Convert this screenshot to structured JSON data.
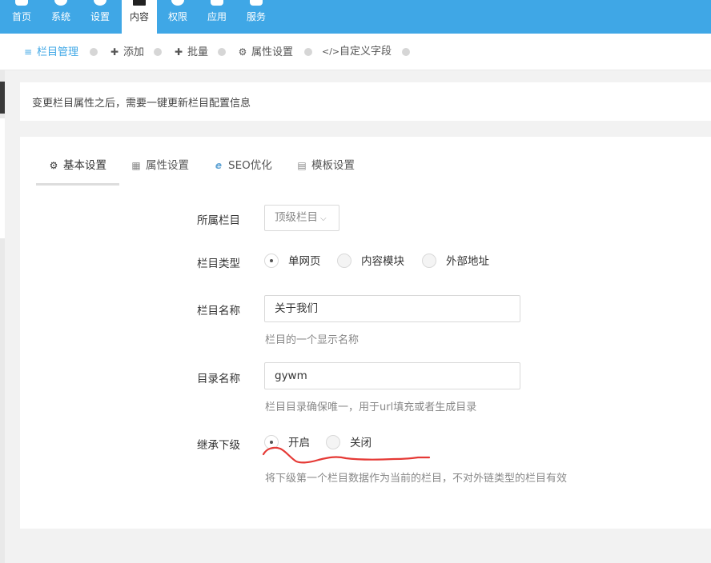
{
  "topnav": {
    "items": [
      {
        "label": "首页",
        "icon": "home-icon"
      },
      {
        "label": "系统",
        "icon": "globe-icon"
      },
      {
        "label": "设置",
        "icon": "gears-icon"
      },
      {
        "label": "内容",
        "icon": "grid-icon",
        "active": true
      },
      {
        "label": "权限",
        "icon": "user-icon"
      },
      {
        "label": "应用",
        "icon": "puzzle-icon"
      },
      {
        "label": "服务",
        "icon": "chat-icon"
      }
    ],
    "bg": "#3fa7e6"
  },
  "subbar": {
    "items": [
      {
        "label": "栏目管理",
        "icon": "≡",
        "active": true
      },
      {
        "label": "添加",
        "icon": "✚"
      },
      {
        "label": "批量",
        "icon": "✚"
      },
      {
        "label": "属性设置",
        "icon": "⚙"
      },
      {
        "label": "自定义字段",
        "icon": "</>"
      }
    ]
  },
  "notice": {
    "text": "变更栏目属性之后，需要一键更新栏目配置信息"
  },
  "tabs": [
    {
      "label": "基本设置",
      "icon": "⚙",
      "active": true
    },
    {
      "label": "属性设置",
      "icon": "▦"
    },
    {
      "label": "SEO优化",
      "icon": "e"
    },
    {
      "label": "模板设置",
      "icon": "▤"
    }
  ],
  "form": {
    "parent": {
      "label": "所属栏目",
      "value": "顶级栏目"
    },
    "type": {
      "label": "栏目类型",
      "options": [
        "单网页",
        "内容模块",
        "外部地址"
      ],
      "selected": "单网页"
    },
    "name": {
      "label": "栏目名称",
      "value": "关于我们",
      "help": "栏目的一个显示名称"
    },
    "dir": {
      "label": "目录名称",
      "value": "gywm",
      "help": "栏目目录确保唯一，用于url填充或者生成目录"
    },
    "inherit": {
      "label": "继承下级",
      "options": [
        "开启",
        "关闭"
      ],
      "selected": "开启",
      "help": "将下级第一个栏目数据作为当前的栏目，不对外链类型的栏目有效"
    }
  },
  "annotation_color": "#e53935"
}
